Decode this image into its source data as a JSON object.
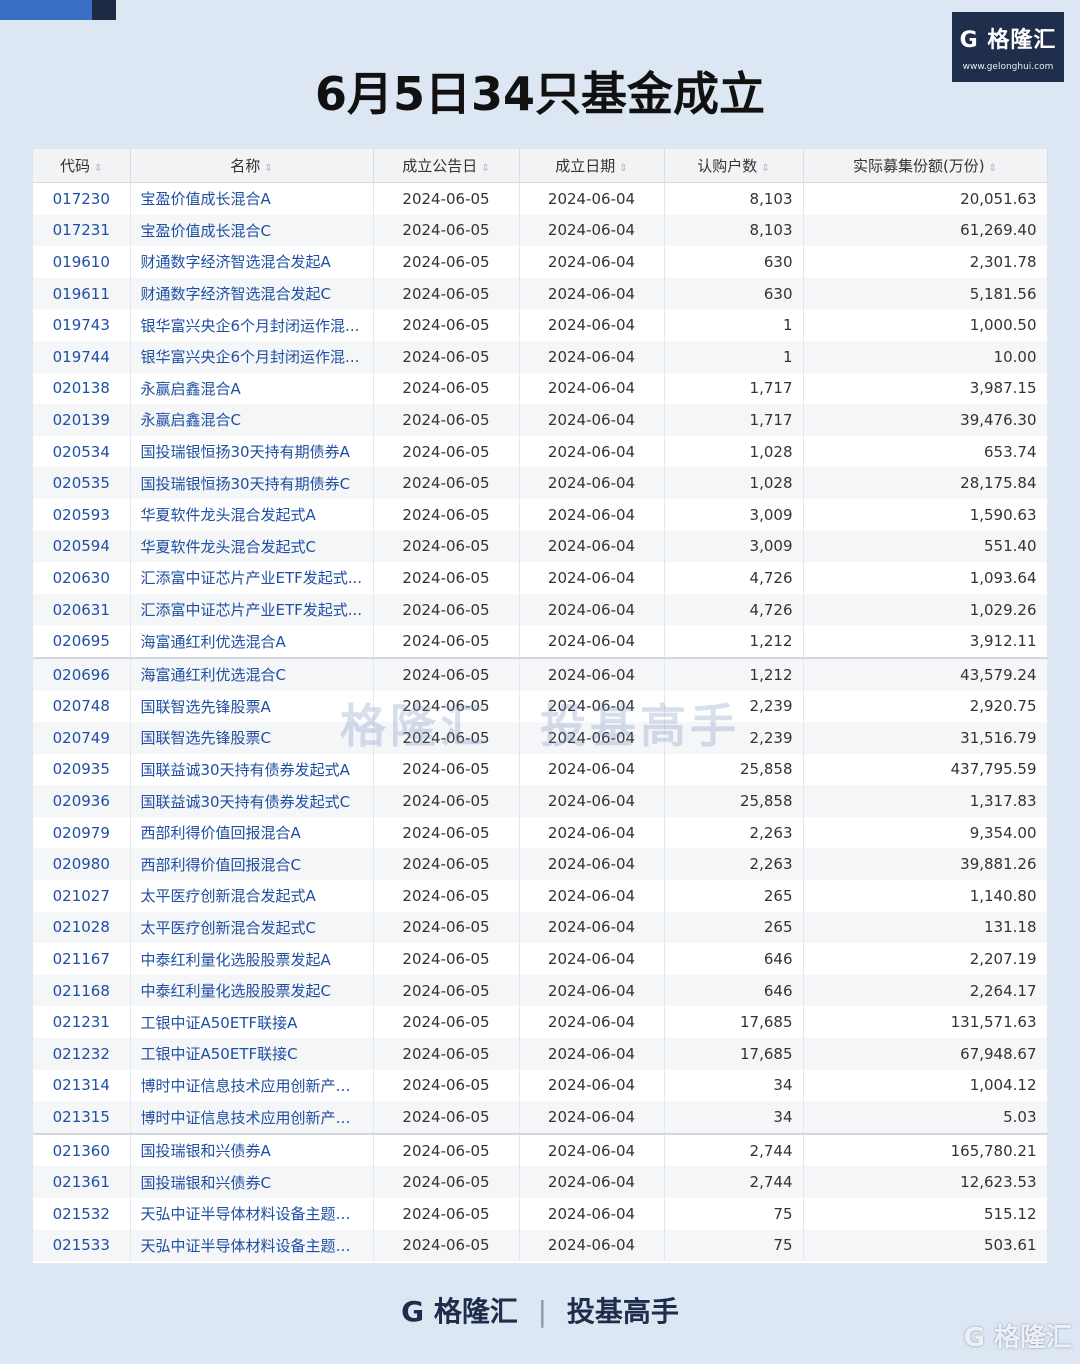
{
  "logo": {
    "text": "G 格隆汇",
    "url": "www.gelonghui.com"
  },
  "title": "6月5日34只基金成立",
  "table": {
    "headers": [
      "代码",
      "名称",
      "成立公告日",
      "成立日期",
      "认购户数",
      "实际募集份额(万份)"
    ],
    "rows": [
      [
        "017230",
        "宝盈价值成长混合A",
        "2024-06-05",
        "2024-06-04",
        "8,103",
        "20,051.63"
      ],
      [
        "017231",
        "宝盈价值成长混合C",
        "2024-06-05",
        "2024-06-04",
        "8,103",
        "61,269.40"
      ],
      [
        "019610",
        "财通数字经济智选混合发起A",
        "2024-06-05",
        "2024-06-04",
        "630",
        "2,301.78"
      ],
      [
        "019611",
        "财通数字经济智选混合发起C",
        "2024-06-05",
        "2024-06-04",
        "630",
        "5,181.56"
      ],
      [
        "019743",
        "银华富兴央企6个月封闭运作混...",
        "2024-06-05",
        "2024-06-04",
        "1",
        "1,000.50"
      ],
      [
        "019744",
        "银华富兴央企6个月封闭运作混...",
        "2024-06-05",
        "2024-06-04",
        "1",
        "10.00"
      ],
      [
        "020138",
        "永赢启鑫混合A",
        "2024-06-05",
        "2024-06-04",
        "1,717",
        "3,987.15"
      ],
      [
        "020139",
        "永赢启鑫混合C",
        "2024-06-05",
        "2024-06-04",
        "1,717",
        "39,476.30"
      ],
      [
        "020534",
        "国投瑞银恒扬30天持有期债券A",
        "2024-06-05",
        "2024-06-04",
        "1,028",
        "653.74"
      ],
      [
        "020535",
        "国投瑞银恒扬30天持有期债券C",
        "2024-06-05",
        "2024-06-04",
        "1,028",
        "28,175.84"
      ],
      [
        "020593",
        "华夏软件龙头混合发起式A",
        "2024-06-05",
        "2024-06-04",
        "3,009",
        "1,590.63"
      ],
      [
        "020594",
        "华夏软件龙头混合发起式C",
        "2024-06-05",
        "2024-06-04",
        "3,009",
        "551.40"
      ],
      [
        "020630",
        "汇添富中证芯片产业ETF发起式...",
        "2024-06-05",
        "2024-06-04",
        "4,726",
        "1,093.64"
      ],
      [
        "020631",
        "汇添富中证芯片产业ETF发起式...",
        "2024-06-05",
        "2024-06-04",
        "4,726",
        "1,029.26"
      ],
      [
        "020695",
        "海富通红利优选混合A",
        "2024-06-05",
        "2024-06-04",
        "1,212",
        "3,912.11"
      ],
      [
        "020696",
        "海富通红利优选混合C",
        "2024-06-05",
        "2024-06-04",
        "1,212",
        "43,579.24"
      ],
      [
        "020748",
        "国联智选先锋股票A",
        "2024-06-05",
        "2024-06-04",
        "2,239",
        "2,920.75"
      ],
      [
        "020749",
        "国联智选先锋股票C",
        "2024-06-05",
        "2024-06-04",
        "2,239",
        "31,516.79"
      ],
      [
        "020935",
        "国联益诚30天持有债券发起式A",
        "2024-06-05",
        "2024-06-04",
        "25,858",
        "437,795.59"
      ],
      [
        "020936",
        "国联益诚30天持有债券发起式C",
        "2024-06-05",
        "2024-06-04",
        "25,858",
        "1,317.83"
      ],
      [
        "020979",
        "西部利得价值回报混合A",
        "2024-06-05",
        "2024-06-04",
        "2,263",
        "9,354.00"
      ],
      [
        "020980",
        "西部利得价值回报混合C",
        "2024-06-05",
        "2024-06-04",
        "2,263",
        "39,881.26"
      ],
      [
        "021027",
        "太平医疗创新混合发起式A",
        "2024-06-05",
        "2024-06-04",
        "265",
        "1,140.80"
      ],
      [
        "021028",
        "太平医疗创新混合发起式C",
        "2024-06-05",
        "2024-06-04",
        "265",
        "131.18"
      ],
      [
        "021167",
        "中泰红利量化选股股票发起A",
        "2024-06-05",
        "2024-06-04",
        "646",
        "2,207.19"
      ],
      [
        "021168",
        "中泰红利量化选股股票发起C",
        "2024-06-05",
        "2024-06-04",
        "646",
        "2,264.17"
      ],
      [
        "021231",
        "工银中证A50ETF联接A",
        "2024-06-05",
        "2024-06-04",
        "17,685",
        "131,571.63"
      ],
      [
        "021232",
        "工银中证A50ETF联接C",
        "2024-06-05",
        "2024-06-04",
        "17,685",
        "67,948.67"
      ],
      [
        "021314",
        "博时中证信息技术应用创新产业...",
        "2024-06-05",
        "2024-06-04",
        "34",
        "1,004.12"
      ],
      [
        "021315",
        "博时中证信息技术应用创新产业...",
        "2024-06-05",
        "2024-06-04",
        "34",
        "5.03"
      ],
      [
        "021360",
        "国投瑞银和兴债券A",
        "2024-06-05",
        "2024-06-04",
        "2,744",
        "165,780.21"
      ],
      [
        "021361",
        "国投瑞银和兴债券C",
        "2024-06-05",
        "2024-06-04",
        "2,744",
        "12,623.53"
      ],
      [
        "021532",
        "天弘中证半导体材料设备主题指...",
        "2024-06-05",
        "2024-06-04",
        "75",
        "515.12"
      ],
      [
        "021533",
        "天弘中证半导体材料设备主题指...",
        "2024-06-05",
        "2024-06-04",
        "75",
        "503.61"
      ]
    ],
    "section_breaks": [
      15,
      30
    ]
  },
  "watermark": {
    "brand": "格隆汇",
    "product": "投基高手"
  },
  "footer": {
    "brand": "G 格隆汇",
    "product": "投基高手"
  },
  "corner_mark": "G 格隆汇"
}
